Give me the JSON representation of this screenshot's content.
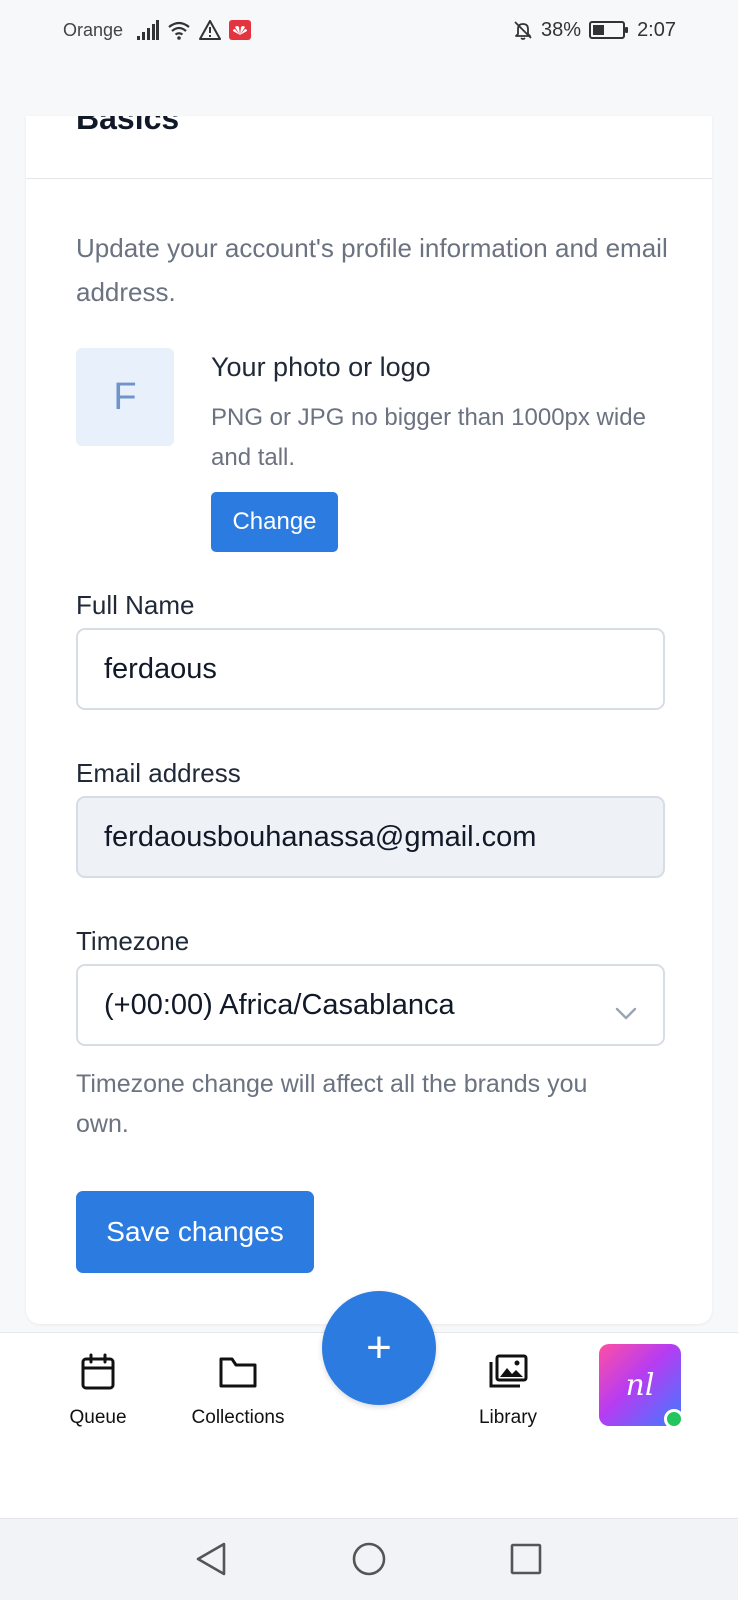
{
  "status_bar": {
    "carrier": "Orange",
    "battery": "38%",
    "battery_level": 0.38,
    "time": "2:07",
    "icons": [
      "signal-icon",
      "wifi-icon",
      "warning-icon",
      "huawei-icon",
      "mute-bell-icon",
      "battery-icon"
    ]
  },
  "card": {
    "title": "Basics",
    "description": "Update your account's profile information and email address.",
    "avatar_letter": "F",
    "photo_title": "Your photo or logo",
    "photo_help": "PNG or JPG no bigger than 1000px wide and tall.",
    "change_label": "Change",
    "full_name_label": "Full Name",
    "full_name_value": "ferdaous",
    "email_label": "Email address",
    "email_value": "ferdaousbouhanassa@gmail.com",
    "timezone_label": "Timezone",
    "timezone_value": "(+00:00) Africa/Casablanca",
    "timezone_help": "Timezone change will affect all the brands you own.",
    "save_label": "Save changes"
  },
  "bottom_nav": {
    "items": [
      {
        "label": "Queue",
        "icon": "calendar-icon"
      },
      {
        "label": "Collections",
        "icon": "folder-icon"
      },
      {
        "label": "Library",
        "icon": "library-icon"
      }
    ],
    "fab_icon": "plus-icon",
    "fab_symbol": "+",
    "app_logo_text": "nl"
  },
  "colors": {
    "accent": "#2b7be0",
    "online": "#22c55e"
  }
}
